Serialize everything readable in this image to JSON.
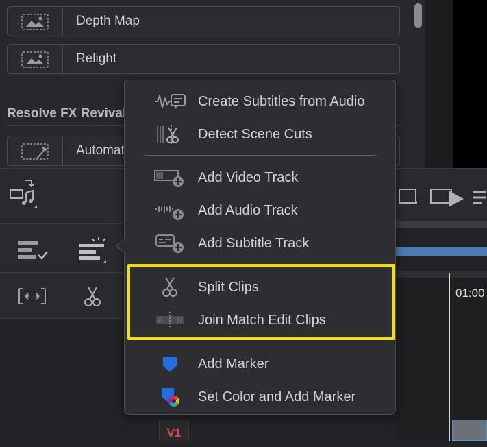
{
  "effects": {
    "items": [
      {
        "label": "Depth Map"
      },
      {
        "label": "Relight"
      },
      {
        "label": "Automat"
      }
    ],
    "group_title": "Resolve FX Revival"
  },
  "timeline": {
    "timecode": "01:00",
    "track_label": "V1"
  },
  "context_menu": {
    "items": [
      {
        "label": "Create Subtitles from Audio",
        "icon": "waveform-subtitle-icon"
      },
      {
        "label": "Detect Scene Cuts",
        "icon": "scene-cut-scissors-icon"
      },
      {
        "label": "Add Video Track",
        "icon": "add-video-track-icon"
      },
      {
        "label": "Add Audio Track",
        "icon": "add-audio-track-icon"
      },
      {
        "label": "Add Subtitle Track",
        "icon": "add-subtitle-track-icon"
      },
      {
        "label": "Split Clips",
        "icon": "scissors-icon"
      },
      {
        "label": "Join Match Edit Clips",
        "icon": "join-clips-icon"
      },
      {
        "label": "Add Marker",
        "icon": "marker-icon"
      },
      {
        "label": "Set Color and Add Marker",
        "icon": "color-marker-icon"
      }
    ]
  },
  "colors": {
    "highlight": "#f2dd0e",
    "marker_blue": "#1f6fe0",
    "track_red": "#e0443e"
  }
}
